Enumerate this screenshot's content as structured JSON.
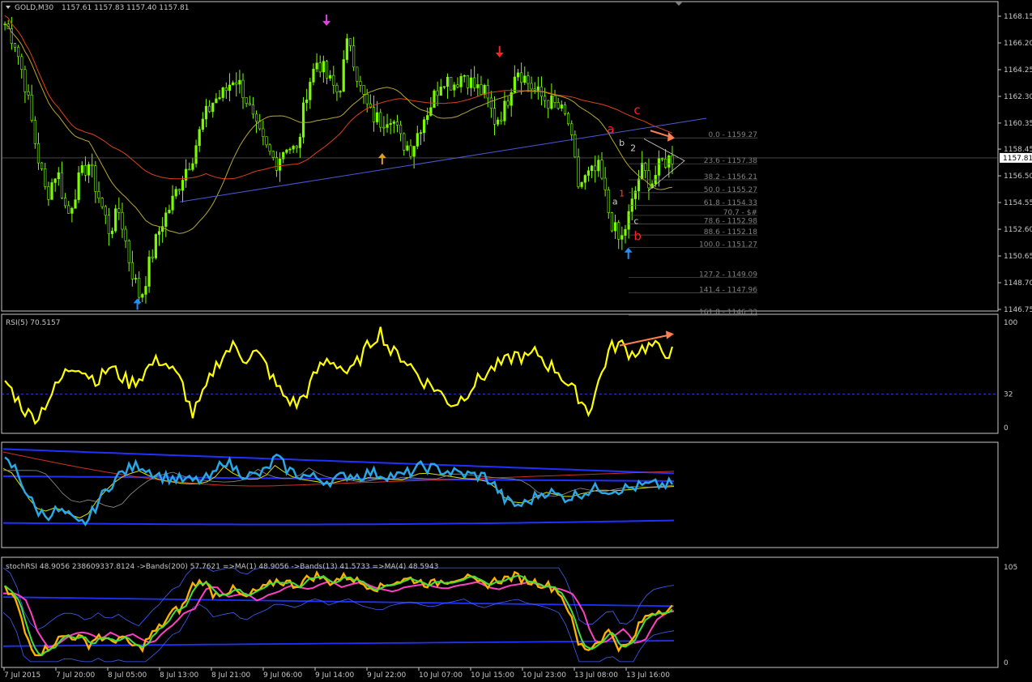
{
  "header": {
    "symbol": "GOLD,M30",
    "ohlc": "1157.61 1157.83 1157.40 1157.81"
  },
  "colors": {
    "background": "#000000",
    "frame": "#c8c8c8",
    "candles": "#7cfc00",
    "ma_slow": "#e0401a",
    "ma_fast": "#b5a830",
    "trendline": "#4a5ad8",
    "rsi": "#ffff00",
    "signal_blue": "#1e90ff",
    "arrow_orange": "#ff7f50",
    "label_red": "#ff2020",
    "stoch_pink": "#ff40c0",
    "stoch_green": "#40e040",
    "stoch_orange": "#ffb000"
  },
  "chart_data": [
    {
      "type": "candlestick",
      "name": "GOLD,M30",
      "ylim": [
        1146.0,
        1169.0
      ],
      "y_ticks": [
        "1168.15",
        "1166.20",
        "1164.25",
        "1162.30",
        "1160.35",
        "1158.45",
        "1156.50",
        "1154.55",
        "1152.60",
        "1150.65",
        "1148.70",
        "1146.75"
      ],
      "current_price": "1157.81",
      "close_path": [
        1167.6,
        1166.2,
        1163.0,
        1158.5,
        1155.0,
        1157.0,
        1153.5,
        1156.0,
        1157.5,
        1155.0,
        1152.5,
        1154.0,
        1150.0,
        1147.5,
        1150.5,
        1153.0,
        1154.5,
        1156.5,
        1158.0,
        1160.5,
        1162.0,
        1162.5,
        1163.8,
        1162.5,
        1160.0,
        1158.5,
        1157.5,
        1158.8,
        1158.2,
        1163.0,
        1165.0,
        1163.5,
        1162.5,
        1166.8,
        1163.0,
        1161.0,
        1160.5,
        1161.0,
        1159.0,
        1158.5,
        1160.5,
        1162.0,
        1163.8,
        1163.2,
        1164.0,
        1163.0,
        1162.5,
        1160.5,
        1161.5,
        1164.5,
        1163.5,
        1162.5,
        1162.0,
        1161.5,
        1160.5,
        1155.8,
        1156.5,
        1157.0,
        1153.5,
        1151.5,
        1154.0,
        1157.0,
        1156.0,
        1157.5,
        1157.81
      ],
      "fib_levels": [
        {
          "label": "0.0 - 1159.27",
          "price": 1159.27
        },
        {
          "label": "23.6 - 1157.38",
          "price": 1157.38
        },
        {
          "label": "38.2 - 1156.21",
          "price": 1156.21
        },
        {
          "label": "50.0 - 1155.27",
          "price": 1155.27
        },
        {
          "label": "61.8 - 1154.33",
          "price": 1154.33
        },
        {
          "label": "70.7 - $#",
          "price": 1153.61
        },
        {
          "label": "78.6 - 1152.98",
          "price": 1152.98
        },
        {
          "label": "88.6 - 1152.18",
          "price": 1152.18
        },
        {
          "label": "100.0 - 1151.27",
          "price": 1151.27
        },
        {
          "label": "127.2 - 1149.09",
          "price": 1149.09
        },
        {
          "label": "141.4 - 1147.96",
          "price": 1147.96
        },
        {
          "label": "161.8 - 1146.33",
          "price": 1146.33
        }
      ],
      "wave_labels": [
        {
          "text": "c",
          "color": "#ff2020",
          "price": 1161.0,
          "bar": 0.94
        },
        {
          "text": "a",
          "color": "#ff2020",
          "price": 1159.6,
          "bar": 0.9
        },
        {
          "text": "b",
          "color": "#cfcfcf",
          "price": 1158.7,
          "bar": 0.918
        },
        {
          "text": "2",
          "color": "#cfcfcf",
          "price": 1158.3,
          "bar": 0.935
        },
        {
          "text": "1",
          "color": "#ff4040",
          "price": 1155.0,
          "bar": 0.918
        },
        {
          "text": "a",
          "color": "#cfcfcf",
          "price": 1154.4,
          "bar": 0.908
        },
        {
          "text": "c",
          "color": "#cfcfcf",
          "price": 1153.0,
          "bar": 0.94
        },
        {
          "text": "b",
          "color": "#ff2020",
          "price": 1151.8,
          "bar": 0.94
        }
      ]
    },
    {
      "type": "line",
      "name": "RSI(5)",
      "value": "70.5157",
      "ylim": [
        0,
        100
      ],
      "y_ticks": [
        "100",
        "32",
        "0"
      ],
      "level": 32,
      "values": [
        45,
        30,
        15,
        8,
        25,
        40,
        55,
        60,
        50,
        45,
        58,
        50,
        42,
        48,
        60,
        65,
        55,
        42,
        12,
        30,
        55,
        70,
        78,
        65,
        72,
        60,
        40,
        28,
        22,
        35,
        55,
        65,
        60,
        50,
        65,
        80,
        92,
        72,
        68,
        58,
        45,
        40,
        30,
        22,
        30,
        42,
        50,
        58,
        62,
        70,
        65,
        72,
        60,
        55,
        40,
        30,
        15,
        45,
        75,
        80,
        70,
        75,
        78,
        73,
        71
      ]
    },
    {
      "type": "line",
      "name": "bands",
      "values": [
        0.85,
        0.78,
        0.55,
        0.35,
        0.3,
        0.35,
        0.3,
        0.2,
        0.25,
        0.45,
        0.6,
        0.72,
        0.78,
        0.82,
        0.75,
        0.7,
        0.68,
        0.66,
        0.65,
        0.66,
        0.7,
        0.88,
        0.78,
        0.72,
        0.7,
        0.75,
        0.9,
        0.78,
        0.72,
        0.7,
        0.68,
        0.65,
        0.68,
        0.72,
        0.7,
        0.74,
        0.72,
        0.71,
        0.7,
        0.75,
        0.8,
        0.78,
        0.76,
        0.74,
        0.72,
        0.71,
        0.7,
        0.6,
        0.45,
        0.4,
        0.42,
        0.5,
        0.55,
        0.5,
        0.48,
        0.52,
        0.55,
        0.58,
        0.56,
        0.57,
        0.58,
        0.6,
        0.61,
        0.61,
        0.62
      ]
    },
    {
      "type": "line",
      "name": "stochRSI",
      "legend": "stochRSI 48.9056 238609337.8124 ->Bands(200) 57.7621 =>MA(1) 48.9056 ->Bands(13) 41.5733 =>MA(4) 48.5943",
      "ylim": [
        0,
        105
      ],
      "y_ticks": [
        "105",
        "0"
      ],
      "values": [
        80,
        70,
        30,
        10,
        15,
        25,
        30,
        28,
        20,
        30,
        22,
        28,
        20,
        15,
        30,
        40,
        55,
        60,
        85,
        90,
        75,
        78,
        80,
        70,
        78,
        82,
        90,
        88,
        85,
        92,
        96,
        88,
        92,
        95,
        88,
        85,
        82,
        88,
        90,
        92,
        88,
        86,
        90,
        92,
        95,
        88,
        85,
        90,
        92,
        95,
        90,
        88,
        85,
        80,
        60,
        20,
        15,
        25,
        35,
        15,
        20,
        45,
        55,
        58,
        60
      ]
    }
  ],
  "x_axis": {
    "labels": [
      "7 Jul 2015",
      "7 Jul 20:00",
      "8 Jul 05:00",
      "8 Jul 13:00",
      "8 Jul 21:00",
      "9 Jul 06:00",
      "9 Jul 14:00",
      "9 Jul 22:00",
      "10 Jul 07:00",
      "10 Jul 15:00",
      "10 Jul 23:00",
      "13 Jul 08:00",
      "13 Jul 16:00"
    ]
  },
  "signal_arrows": [
    {
      "name": "down-arrow-magenta",
      "color": "#e040e0",
      "bar": 0.482,
      "price": 1167.8,
      "dir": "down"
    },
    {
      "name": "down-arrow-red",
      "color": "#ff2020",
      "bar": 0.74,
      "price": 1165.5,
      "dir": "down"
    },
    {
      "name": "up-arrow-orange",
      "color": "#e0a020",
      "bar": 0.565,
      "price": 1157.8,
      "dir": "up"
    },
    {
      "name": "up-arrow-blue-left",
      "color": "#1e90ff",
      "bar": 0.2,
      "price": 1147.2,
      "dir": "up"
    },
    {
      "name": "up-arrow-blue-right",
      "color": "#1e90ff",
      "bar": 0.932,
      "price": 1150.9,
      "dir": "up"
    }
  ]
}
